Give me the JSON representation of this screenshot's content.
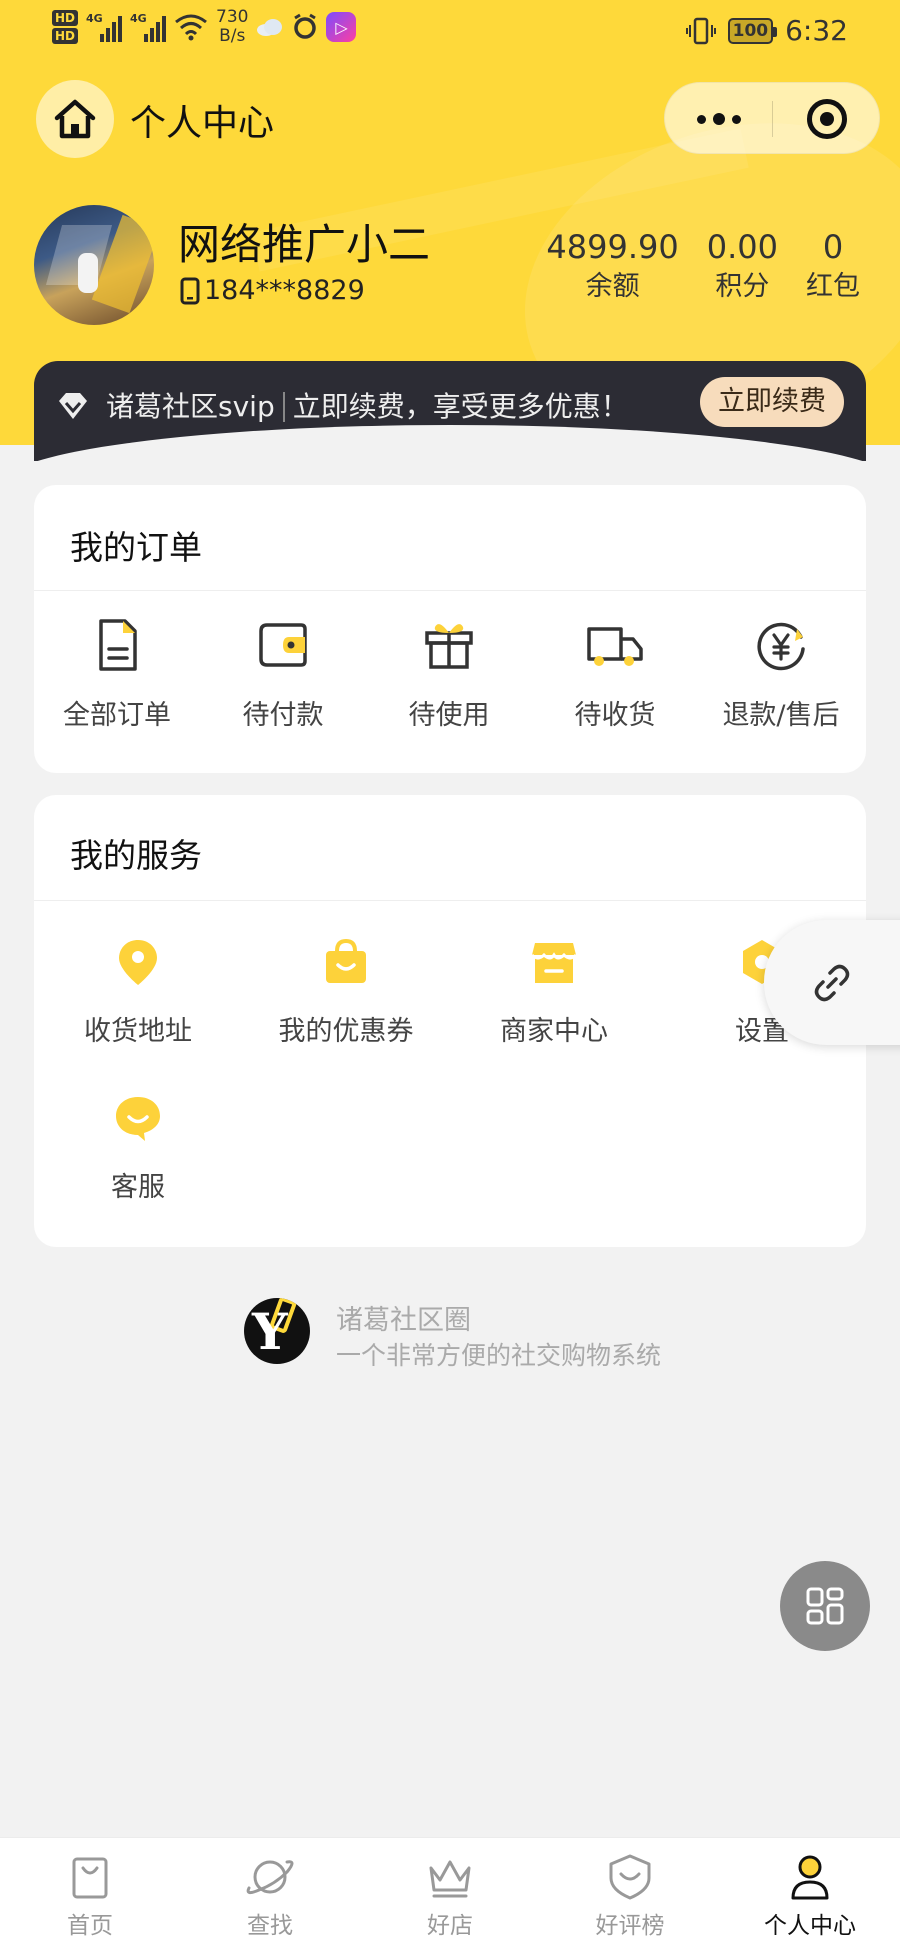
{
  "status_bar": {
    "hd1": "HD",
    "hd2": "HD",
    "sig1": "4G",
    "sig2": "4G",
    "net_speed": "730",
    "net_unit": "B/s",
    "battery": "100",
    "time": "6:32"
  },
  "nav": {
    "title": "个人中心"
  },
  "profile": {
    "nickname": "网络推广小二",
    "phone": "184***8829",
    "stats": [
      {
        "value": "4899.90",
        "label": "余额"
      },
      {
        "value": "0.00",
        "label": "积分"
      },
      {
        "value": "0",
        "label": "红包"
      }
    ]
  },
  "svip": {
    "name": "诸葛社区svip",
    "promo": "立即续费，享受更多优惠！",
    "button": "立即续费"
  },
  "orders": {
    "title": "我的订单",
    "items": [
      {
        "label": "全部订单",
        "icon": "document-icon"
      },
      {
        "label": "待付款",
        "icon": "wallet-icon"
      },
      {
        "label": "待使用",
        "icon": "gift-icon"
      },
      {
        "label": "待收货",
        "icon": "truck-icon"
      },
      {
        "label": "退款/售后",
        "icon": "refund-yen-icon"
      }
    ]
  },
  "services": {
    "title": "我的服务",
    "items": [
      {
        "label": "收货地址",
        "icon": "location-pin-icon"
      },
      {
        "label": "我的优惠券",
        "icon": "shopping-bag-icon"
      },
      {
        "label": "商家中心",
        "icon": "store-icon"
      },
      {
        "label": "设置",
        "icon": "settings-hexagon-icon"
      },
      {
        "label": "客服",
        "icon": "chat-bubble-icon"
      }
    ]
  },
  "brand": {
    "name": "诸葛社区圈",
    "slogan": "一个非常方便的社交购物系统"
  },
  "tabs": [
    {
      "label": "首页",
      "icon": "bag-icon"
    },
    {
      "label": "查找",
      "icon": "planet-icon"
    },
    {
      "label": "好店",
      "icon": "crown-icon"
    },
    {
      "label": "好评榜",
      "icon": "shield-smile-icon"
    },
    {
      "label": "个人中心",
      "icon": "person-icon",
      "active": true
    }
  ],
  "colors": {
    "brand_yellow": "#fed93a",
    "svip_dark": "#2c2c34",
    "svip_button": "#f7dcbc",
    "icon_yellow": "#fdd23a"
  }
}
